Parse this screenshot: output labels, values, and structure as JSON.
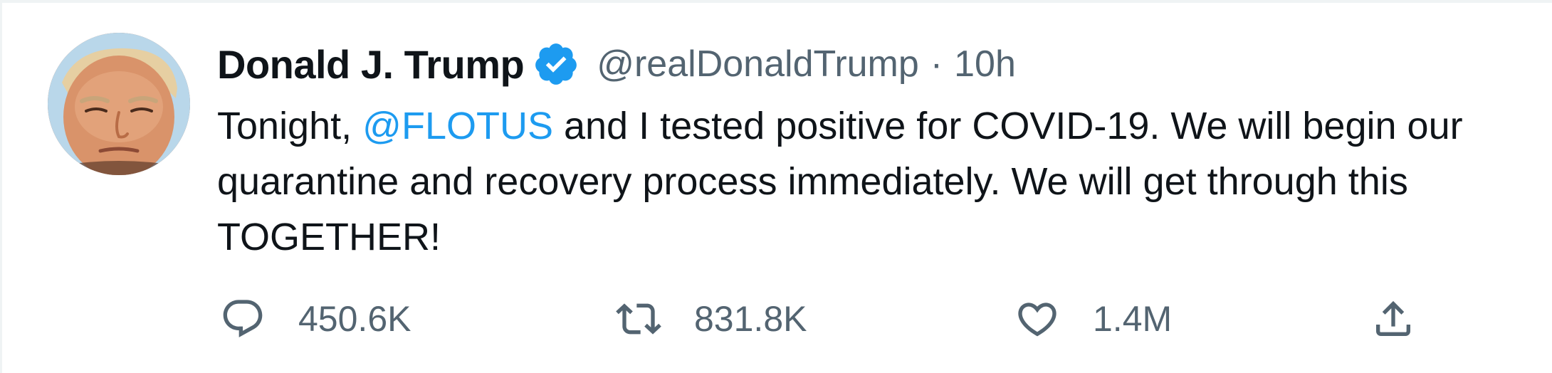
{
  "tweet": {
    "author": {
      "name": "Donald J. Trump",
      "handle": "@realDonaldTrump",
      "verified": true,
      "avatar_icon": "profile-photo"
    },
    "separator": "·",
    "timestamp": "10h",
    "text": {
      "before_mention": "Tonight, ",
      "mention": "@FLOTUS",
      "after_mention": " and I tested positive for COVID-19. We will begin our quarantine and recovery process immediately. We will get through this TOGETHER!"
    },
    "actions": {
      "reply": {
        "icon": "reply-icon",
        "count": "450.6K"
      },
      "retweet": {
        "icon": "retweet-icon",
        "count": "831.8K"
      },
      "like": {
        "icon": "heart-icon",
        "count": "1.4M"
      },
      "share": {
        "icon": "share-icon"
      }
    },
    "colors": {
      "text": "#0f1419",
      "secondary": "#536471",
      "link": "#1d9bf0",
      "verified": "#1d9bf0"
    }
  }
}
